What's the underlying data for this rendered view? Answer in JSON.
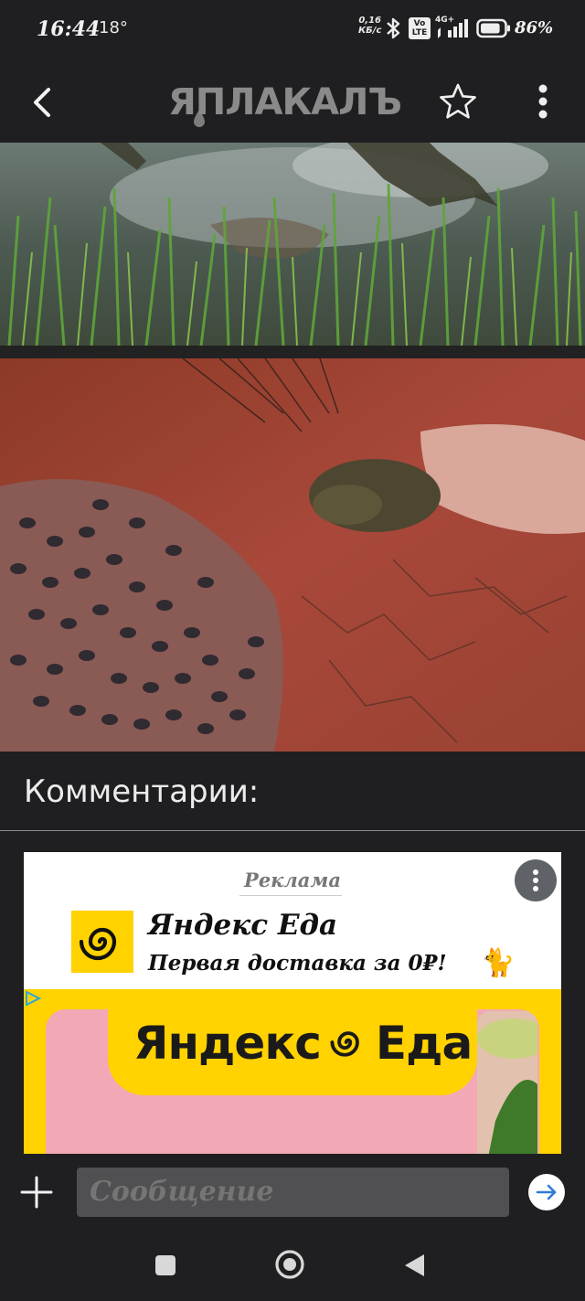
{
  "status_bar": {
    "time": "16:44",
    "temperature": "18°",
    "net_speed_value": "0,16",
    "net_speed_unit": "КБ/с",
    "network_type": "4G+",
    "volte": "Vo LTE",
    "battery_percent": "86%",
    "battery_level": 0.86
  },
  "toolbar": {
    "logo_text": "ЯПЛАКАЛЪ",
    "back_icon": "chevron-left-icon",
    "star_icon": "star-outline-icon",
    "menu_icon": "dots-vertical-icon"
  },
  "images": {
    "top": "Frog splashing through grass and water",
    "bottom": "Frog in red mud beside a pool full of tadpoles"
  },
  "comments": {
    "title": "Комментарии:"
  },
  "ad": {
    "label": "Реклама",
    "brand": "Яндекс Еда",
    "tagline": "Первая доставка за 0₽!",
    "emoji": "🐈",
    "banner_brand_left": "Яндекс",
    "banner_brand_right": "Еда",
    "brand_color": "#ffd200",
    "banner_bg_color": "#f3a8b6"
  },
  "message_bar": {
    "placeholder": "Сообщение"
  },
  "colors": {
    "background": "#1f1f21",
    "input_bg": "#505052",
    "send_arrow": "#2f7bd6"
  }
}
